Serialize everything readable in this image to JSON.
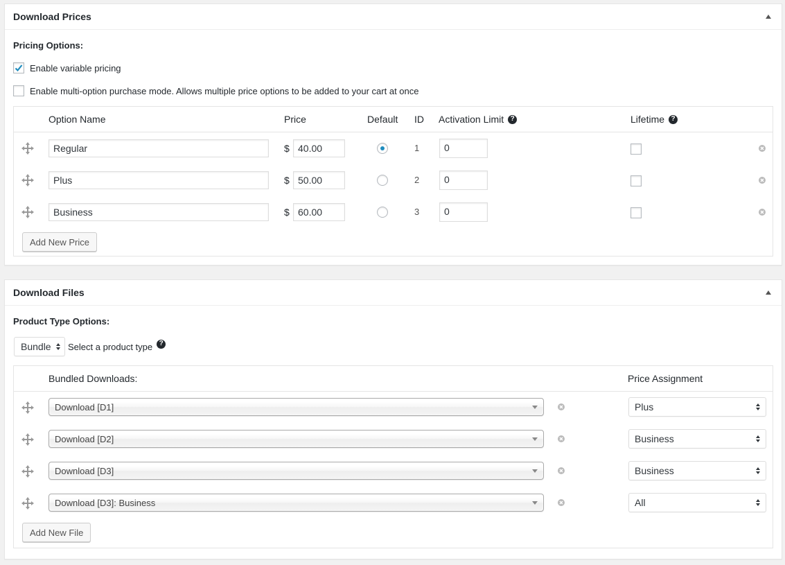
{
  "prices_box": {
    "title": "Download Prices",
    "pricing_options_label": "Pricing Options:",
    "enable_variable_pricing": {
      "label": "Enable variable pricing",
      "checked": true
    },
    "enable_multi_option": {
      "label": "Enable multi-option purchase mode. Allows multiple price options to be added to your cart at once",
      "checked": false
    },
    "columns": {
      "option_name": "Option Name",
      "price": "Price",
      "default": "Default",
      "id": "ID",
      "activation_limit": "Activation Limit",
      "lifetime": "Lifetime"
    },
    "currency_symbol": "$",
    "rows": [
      {
        "name": "Regular",
        "price": "40.00",
        "default": true,
        "id": "1",
        "activation_limit": "0",
        "lifetime": false
      },
      {
        "name": "Plus",
        "price": "50.00",
        "default": false,
        "id": "2",
        "activation_limit": "0",
        "lifetime": false
      },
      {
        "name": "Business",
        "price": "60.00",
        "default": false,
        "id": "3",
        "activation_limit": "0",
        "lifetime": false
      }
    ],
    "add_button": "Add New Price"
  },
  "files_box": {
    "title": "Download Files",
    "product_type_label": "Product Type Options:",
    "product_type_value": "Bundle",
    "product_type_hint": "Select a product type",
    "columns": {
      "bundled_downloads": "Bundled Downloads:",
      "price_assignment": "Price Assignment"
    },
    "rows": [
      {
        "download": "Download [D1]",
        "assignment": "Plus"
      },
      {
        "download": "Download [D2]",
        "assignment": "Business"
      },
      {
        "download": "Download [D3]",
        "assignment": "Business"
      },
      {
        "download": "Download [D3]: Business",
        "assignment": "All"
      }
    ],
    "add_button": "Add New File"
  },
  "icons": {
    "toggle": "triangle-up-icon",
    "drag": "move-arrows-icon",
    "help": "question-circle-icon",
    "remove": "remove-circle-icon"
  },
  "colors": {
    "accent": "#1e8cbe",
    "background": "#f1f1f1",
    "panel": "#ffffff",
    "border": "#e5e5e5"
  }
}
